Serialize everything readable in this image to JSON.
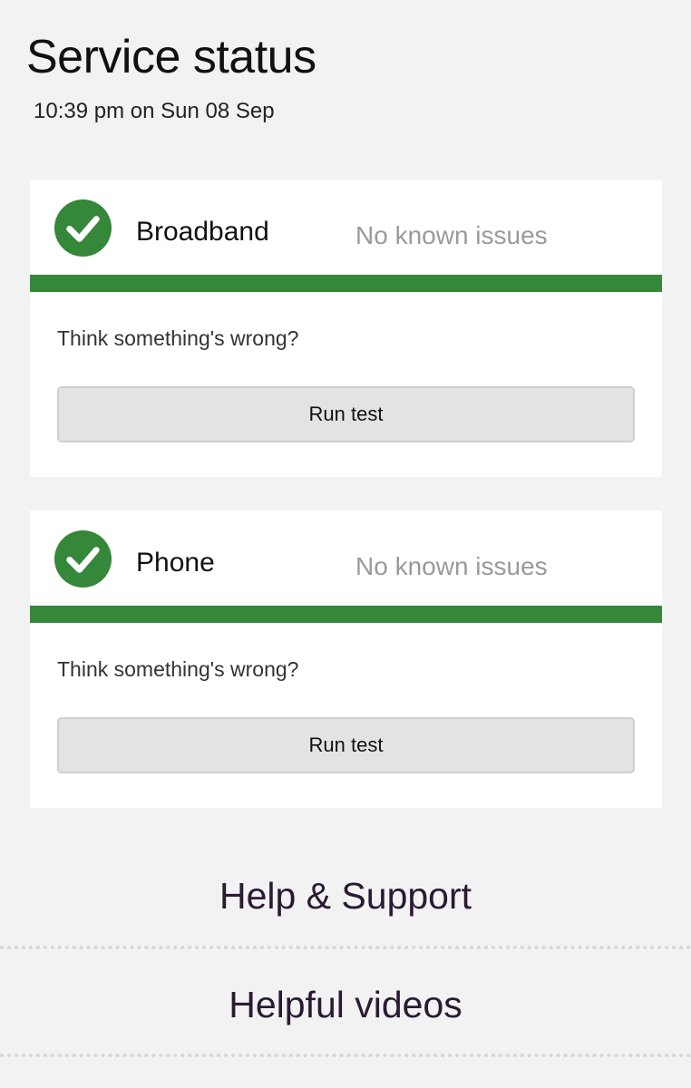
{
  "header": {
    "title": "Service status",
    "timestamp": "10:39 pm on Sun 08 Sep"
  },
  "services": [
    {
      "name": "Broadband",
      "status": "No known issues",
      "prompt": "Think something's wrong?",
      "button_label": "Run test",
      "icon": "check-circle-icon"
    },
    {
      "name": "Phone",
      "status": "No known issues",
      "prompt": "Think something's wrong?",
      "button_label": "Run test",
      "icon": "check-circle-icon"
    }
  ],
  "links": [
    {
      "label": "Help & Support"
    },
    {
      "label": "Helpful videos"
    }
  ],
  "colors": {
    "status_ok": "#35873a",
    "background": "#f2f2f2",
    "card": "#ffffff",
    "button": "#e3e3e3",
    "status_text": "#9a9a9a",
    "link_text": "#2a1a33"
  }
}
